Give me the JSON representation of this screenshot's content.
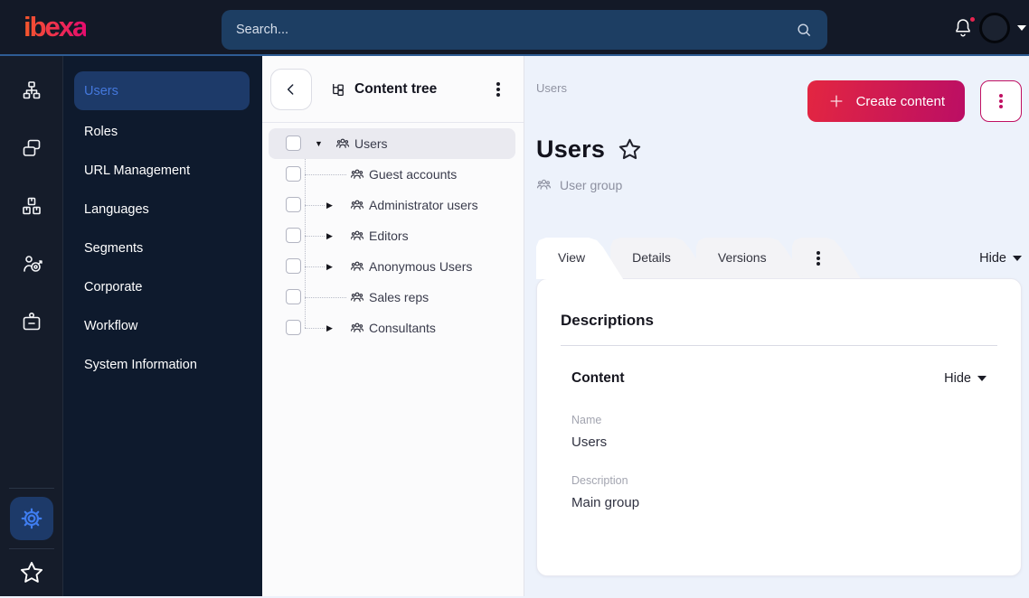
{
  "topbar": {
    "logo_text": "ibexa",
    "search": {
      "placeholder": "Search..."
    },
    "notifications": {
      "has_unread": true
    },
    "icons": {
      "search-icon": "magnifier",
      "bell-icon": "notification bell with red unread dot",
      "avatar": "empty dark user avatar circle",
      "chevron-down-icon": "dropdown caret"
    }
  },
  "sidebar": {
    "rail": [
      {
        "icon": "sitemap-icon"
      },
      {
        "icon": "pages-icon"
      },
      {
        "icon": "products-icon"
      },
      {
        "icon": "personalization-icon"
      },
      {
        "icon": "admin-badge-icon"
      }
    ],
    "rail_bottom": [
      {
        "icon": "gear-icon",
        "active": true
      },
      {
        "icon": "star-icon",
        "active": false
      }
    ],
    "menu_items": [
      {
        "label": "Users",
        "active": true
      },
      {
        "label": "Roles"
      },
      {
        "label": "URL Management"
      },
      {
        "label": "Languages"
      },
      {
        "label": "Segments"
      },
      {
        "label": "Corporate"
      },
      {
        "label": "Workflow"
      },
      {
        "label": "System Information"
      }
    ]
  },
  "content_tree": {
    "title": "Content tree",
    "items": [
      {
        "label": "Users",
        "level": 0,
        "caret": "down",
        "selected": true,
        "icon": "user-group-icon"
      },
      {
        "label": "Guest accounts",
        "level": 1,
        "caret": "none",
        "icon": "user-group-icon"
      },
      {
        "label": "Administrator users",
        "level": 1,
        "caret": "right",
        "icon": "user-group-icon"
      },
      {
        "label": "Editors",
        "level": 1,
        "caret": "right",
        "icon": "user-group-icon"
      },
      {
        "label": "Anonymous Users",
        "level": 1,
        "caret": "right",
        "icon": "user-group-icon"
      },
      {
        "label": "Sales reps",
        "level": 1,
        "caret": "none",
        "icon": "user-group-icon"
      },
      {
        "label": "Consultants",
        "level": 1,
        "caret": "right",
        "icon": "user-group-icon"
      }
    ]
  },
  "main": {
    "breadcrumb": "Users",
    "create_button_label": "Create content",
    "page_title": "Users",
    "content_type_label": "User group",
    "tabs": [
      {
        "label": "View",
        "active": true
      },
      {
        "label": "Details"
      },
      {
        "label": "Versions"
      }
    ],
    "hide_toggle_label": "Hide",
    "card": {
      "heading": "Descriptions",
      "section_heading": "Content",
      "section_hide_label": "Hide",
      "fields": [
        {
          "label": "Name",
          "value": "Users"
        },
        {
          "label": "Description",
          "value": "Main group"
        }
      ]
    }
  },
  "colors": {
    "topbar_bg": "#131927",
    "topbar_accent_line": "#2e5c94",
    "search_bg": "#1d3e63",
    "rail_bg": "#151c2a",
    "menu_bg": "#0e1a2d",
    "selected_item_bg": "#1d3a69",
    "selected_item_text": "#4478dd",
    "gear_active": "#3f7df0",
    "brand_gradient_start": "#e32641",
    "brand_gradient_end": "#bb0e64",
    "accent_magenta": "#c01062",
    "notification_dot": "#e8244f",
    "main_bg": "#edf2fb",
    "tree_selected_row": "#eaeaf0"
  }
}
